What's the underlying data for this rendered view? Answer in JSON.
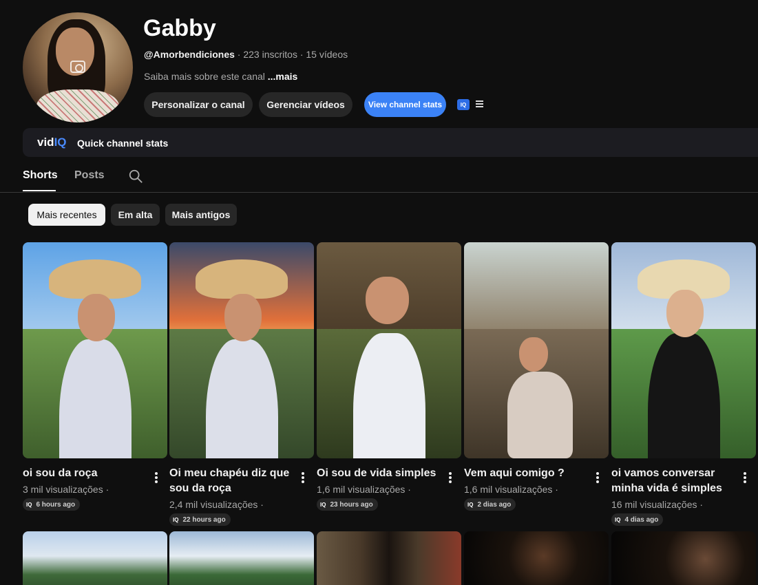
{
  "channel": {
    "name": "Gabby",
    "handle": "@Amorbendiciones",
    "subscribers": "· 223 inscritos",
    "videos": "· 15 vídeos",
    "about": "Saiba mais sobre este canal",
    "about_more": "...mais"
  },
  "actions": {
    "personalize": "Personalizar o canal",
    "manage": "Gerenciar vídeos",
    "stats": "View channel stats",
    "iq_badge": "IQ"
  },
  "vidiq": {
    "logo_vid": "vid",
    "logo_iq": "IQ",
    "label": "Quick channel stats"
  },
  "tabs": {
    "shorts": "Shorts",
    "posts": "Posts"
  },
  "chips": {
    "recent": "Mais recentes",
    "trending": "Em alta",
    "oldest": "Mais antigos"
  },
  "colors": {
    "accent": "#3b82f6",
    "background": "#0f0f0f"
  },
  "videos": [
    {
      "title": "oi sou da roça",
      "views": "3 mil visualizações ·",
      "age": "6 hours ago"
    },
    {
      "title": "Oi meu chapéu diz que sou da roça",
      "views": "2,4 mil visualizações ·",
      "age": "22 hours ago"
    },
    {
      "title": "Oi sou de vida simples",
      "views": "1,6 mil visualizações ·",
      "age": "23 hours ago"
    },
    {
      "title": "Vem aqui comigo ?",
      "views": "1,6 mil visualizações ·",
      "age": "2 dias ago"
    },
    {
      "title": "oi vamos conversar minha vida é simples",
      "views": "16 mil visualizações ·",
      "age": "4 dias ago"
    }
  ],
  "badge_icon": "IQ"
}
